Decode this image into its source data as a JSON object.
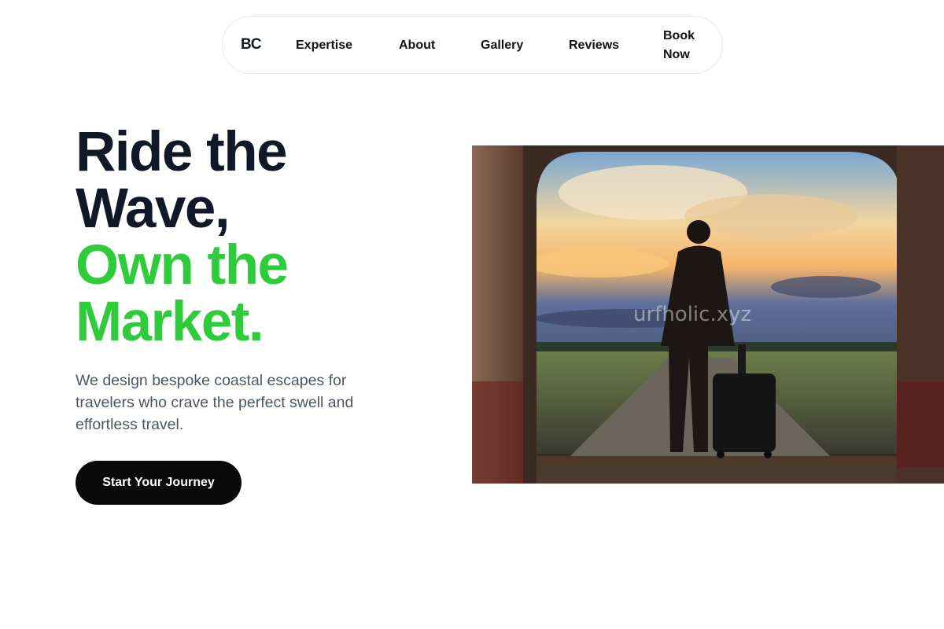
{
  "nav": {
    "logo": "BC",
    "links": [
      "Expertise",
      "About",
      "Gallery",
      "Reviews"
    ],
    "book": "Book Now"
  },
  "hero": {
    "headline_dark_1": "Ride the",
    "headline_dark_2": "Wave,",
    "headline_green_1": "Own the",
    "headline_green_2": "Market.",
    "description": "We design bespoke coastal escapes for travelers who crave the perfect swell and effortless travel.",
    "cta": "Start Your Journey",
    "image_watermark": "urfholic.xyz"
  },
  "colors": {
    "accent_green": "#2ecc3a",
    "dark": "#111827",
    "button": "#0a0a0a"
  }
}
